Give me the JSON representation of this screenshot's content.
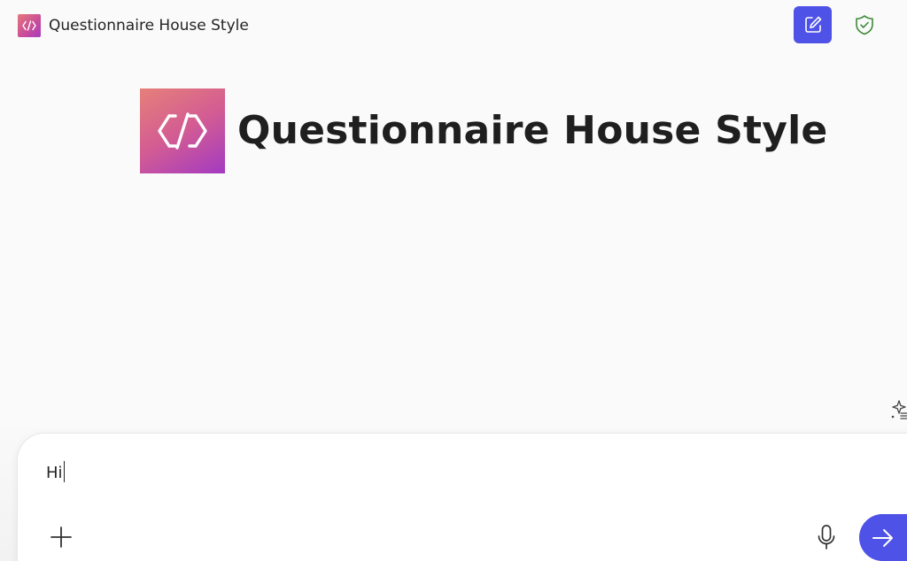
{
  "header": {
    "app_title": "Questionnaire House Style",
    "logo_icon": "code-brackets-icon",
    "new_chat_icon": "compose-icon",
    "shield_icon": "shield-check-icon"
  },
  "hero": {
    "title": "Questionnaire House Style",
    "logo_icon": "code-brackets-icon"
  },
  "suggestions": {
    "icon": "sparkle-list-icon"
  },
  "composer": {
    "input_value": "Hi",
    "add_icon": "plus-icon",
    "mic_icon": "microphone-icon",
    "send_icon": "arrow-right-icon"
  },
  "colors": {
    "accent": "#4f52e6",
    "logo_gradient_start": "#e68079",
    "logo_gradient_end": "#a33ac2",
    "shield_green": "#3c8a3a",
    "background": "#fafafa"
  }
}
